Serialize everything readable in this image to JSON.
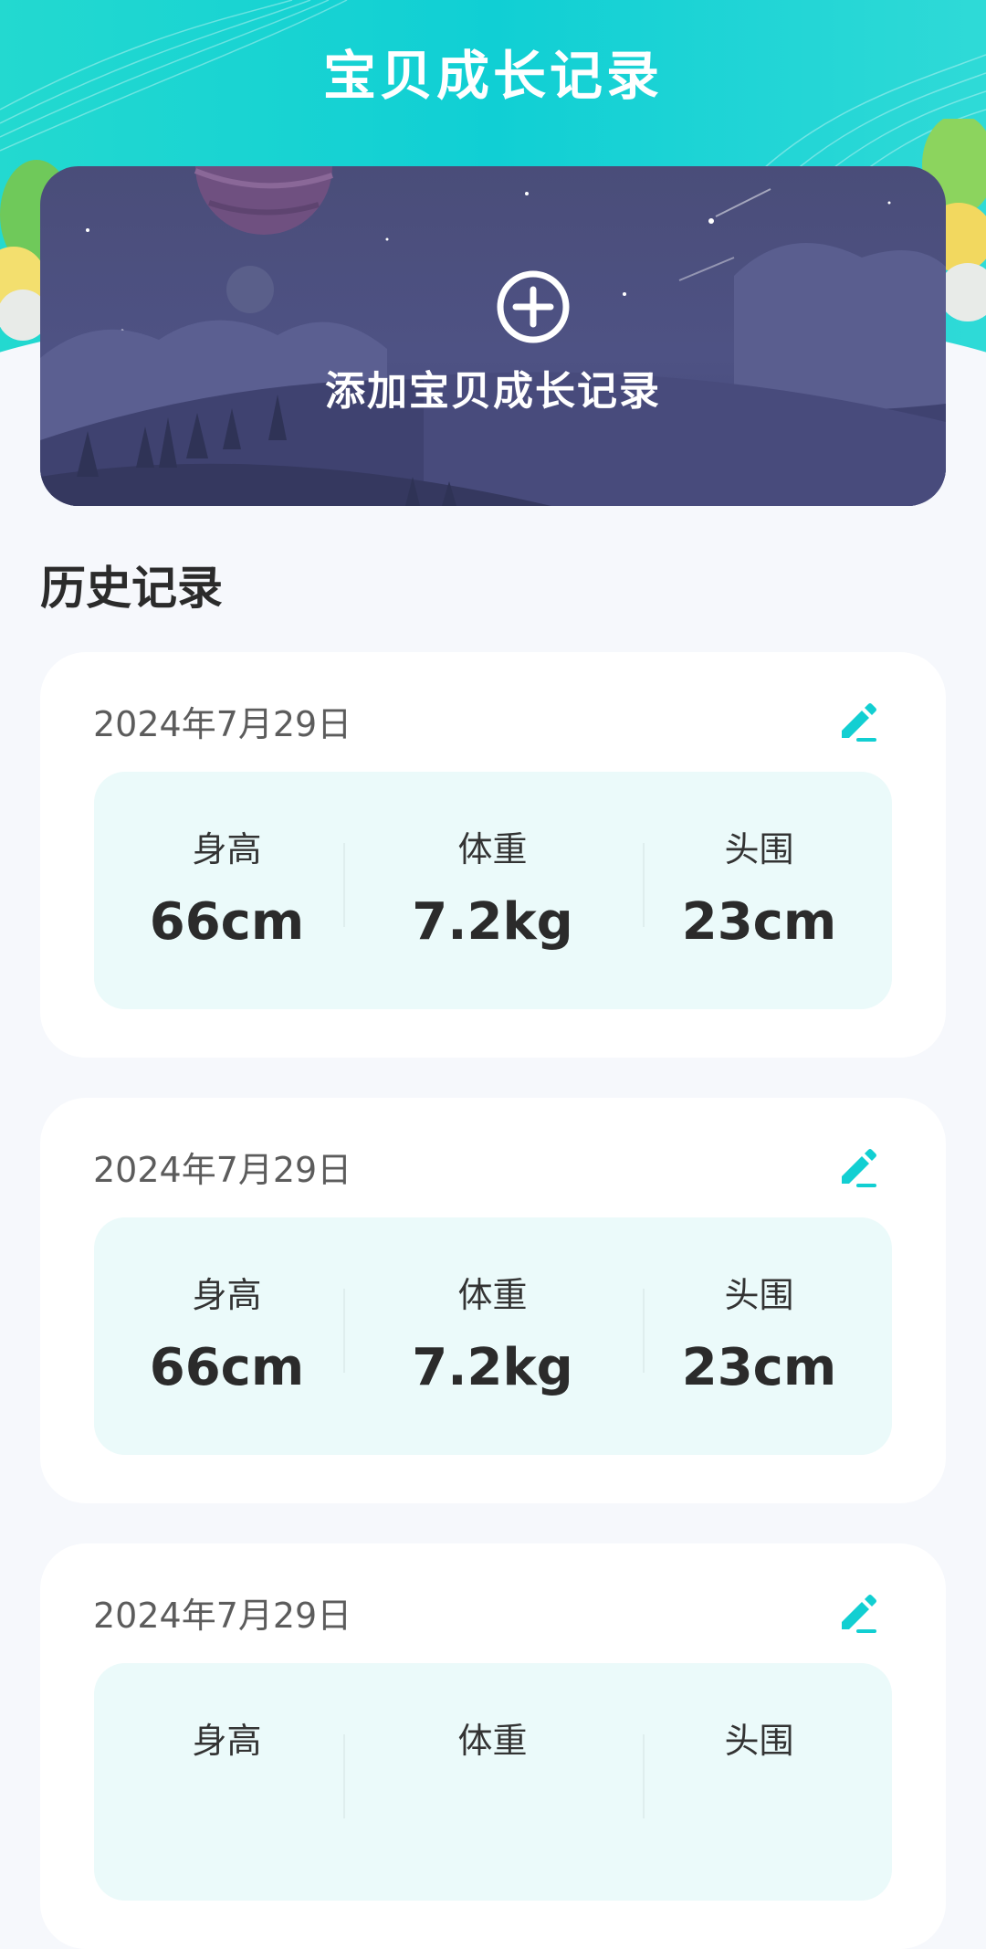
{
  "header": {
    "title": "宝贝成长记录"
  },
  "banner": {
    "add_label": "添加宝贝成长记录",
    "add_icon": "plus-circle-icon"
  },
  "history": {
    "title": "历史记录",
    "records": [
      {
        "date": "2024年7月29日",
        "height_label": "身高",
        "height": "66cm",
        "weight_label": "体重",
        "weight": "7.2kg",
        "head_label": "头围",
        "head": "23cm"
      },
      {
        "date": "2024年7月29日",
        "height_label": "身高",
        "height": "66cm",
        "weight_label": "体重",
        "weight": "7.2kg",
        "head_label": "头围",
        "head": "23cm"
      },
      {
        "date": "2024年7月29日",
        "height_label": "身高",
        "height": "",
        "weight_label": "体重",
        "weight": "",
        "head_label": "头围",
        "head": ""
      }
    ]
  },
  "colors": {
    "accent": "#12cfd2",
    "background": "#f6f8fc",
    "stats_bg": "#ebfafa"
  }
}
